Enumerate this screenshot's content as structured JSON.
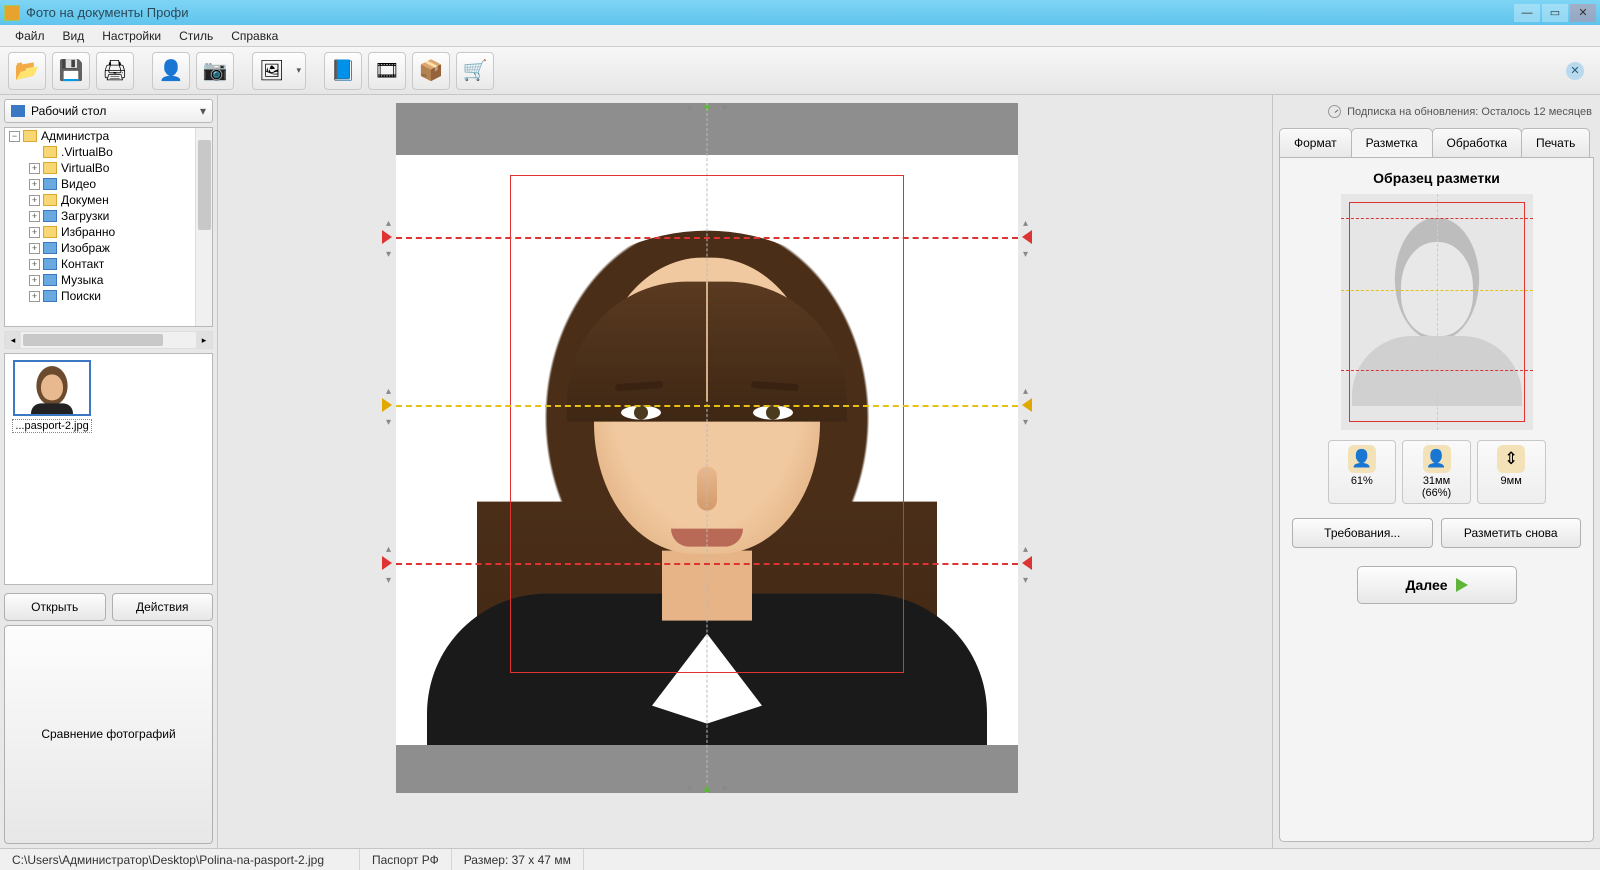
{
  "app": {
    "title": "Фото на документы Профи"
  },
  "menu": {
    "file": "Файл",
    "view": "Вид",
    "settings": "Настройки",
    "style": "Стиль",
    "help": "Справка"
  },
  "toolbar_icons": {
    "open": "📂",
    "save": "💾",
    "print": "🖨",
    "user": "👤",
    "camera": "📷",
    "gallery": "🖼",
    "help_book": "📘",
    "video": "🎞",
    "updates": "📦",
    "cart": "🛒"
  },
  "left": {
    "location": "Рабочий стол",
    "tree": {
      "root": "Администра",
      "items": [
        ".VirtualBo",
        "VirtualBo",
        "Видео",
        "Докумен",
        "Загрузки",
        "Избранно",
        "Изображ",
        "Контакт",
        "Музыка",
        "Поиски"
      ]
    },
    "thumb_label": "...pasport-2.jpg",
    "open": "Открыть",
    "actions": "Действия",
    "compare": "Сравнение фотографий"
  },
  "right": {
    "subscription": "Подписка на обновления: Осталось 12 месяцев",
    "tabs": {
      "format": "Формат",
      "markup": "Разметка",
      "processing": "Обработка",
      "print": "Печать"
    },
    "sample_title": "Образец разметки",
    "metrics": {
      "m1": "61%",
      "m2": "31мм (66%)",
      "m3": "9мм"
    },
    "requirements": "Требования...",
    "remark": "Разметить снова",
    "next": "Далее"
  },
  "status": {
    "path": "C:\\Users\\Администратор\\Desktop\\Polina-na-pasport-2.jpg",
    "doc_type": "Паспорт РФ",
    "size": "Размер: 37 x 47 мм"
  }
}
